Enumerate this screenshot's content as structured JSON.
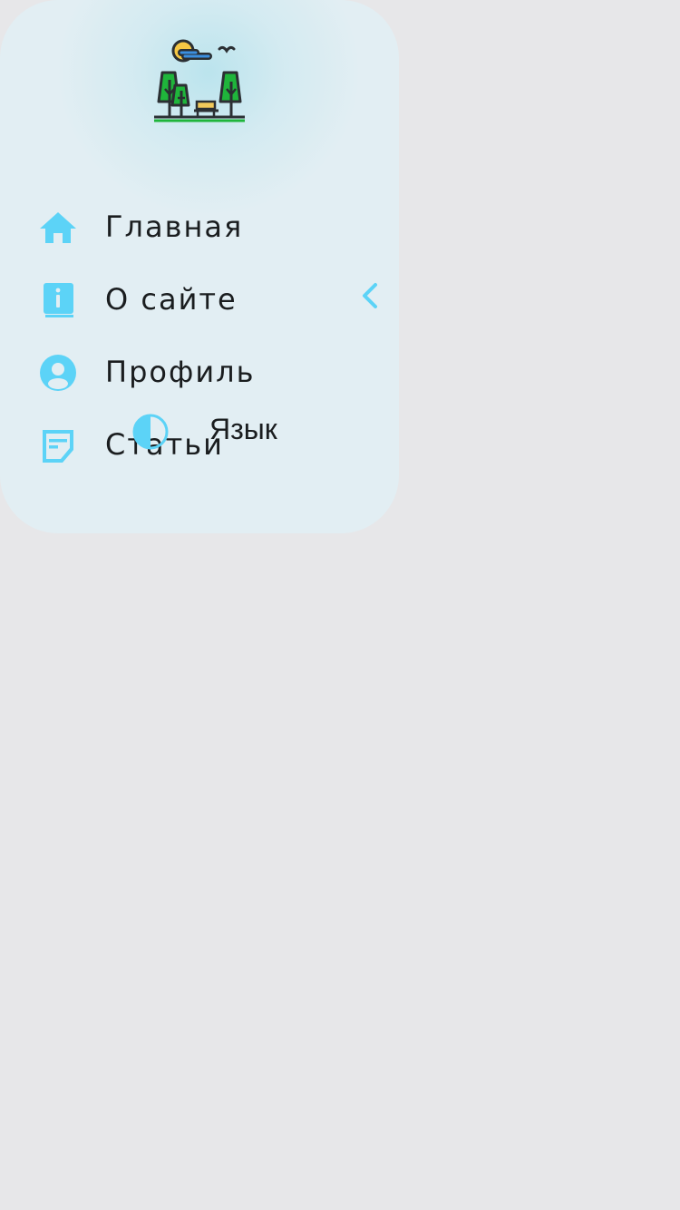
{
  "colors": {
    "accent": "#5cd3f7",
    "panel": "#e2eef3",
    "page": "#e7e7e9",
    "text": "#1a1d1f"
  },
  "logo": {
    "icon": "park-logo-icon"
  },
  "menu": {
    "items": [
      {
        "label": "Главная",
        "icon": "home-icon"
      },
      {
        "label": "О сайте",
        "icon": "info-book-icon"
      },
      {
        "label": "Профиль",
        "icon": "user-circle-icon"
      },
      {
        "label": "Статьи",
        "icon": "notes-icon"
      }
    ],
    "collapse_icon": "chevron-left-icon"
  },
  "theme_toggle": {
    "icon": "contrast-icon"
  },
  "language": {
    "label": "Язык"
  }
}
